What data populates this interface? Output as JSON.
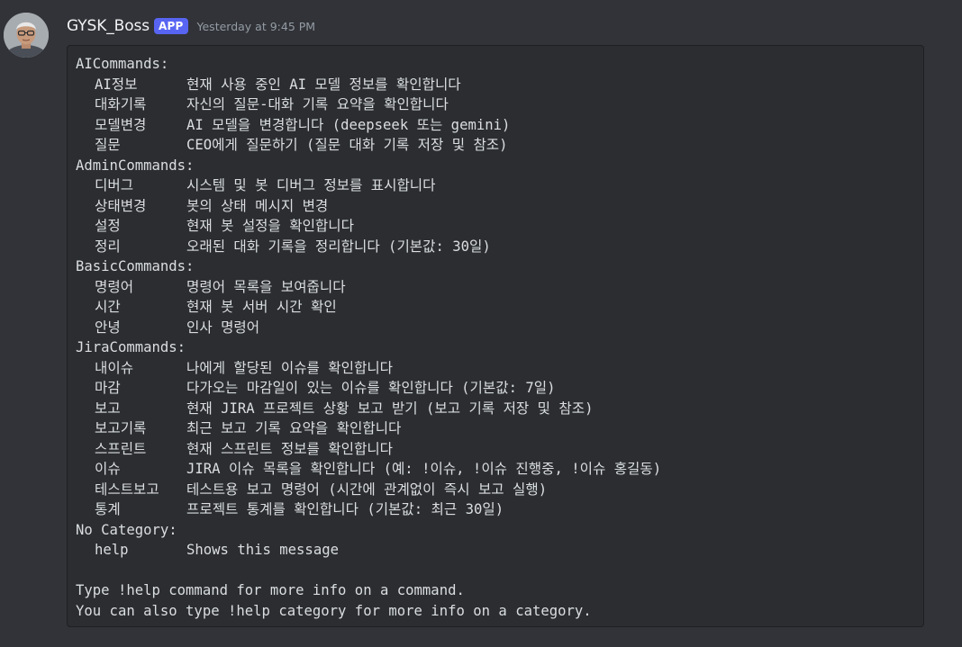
{
  "message": {
    "username": "GYSK_Boss",
    "badge": "APP",
    "timestamp": "Yesterday at 9:45 PM",
    "avatar_icon": "avatar-person-glasses"
  },
  "help": {
    "ai": {
      "title": "AICommands:",
      "items": [
        {
          "cmd": "AI정보",
          "desc": "현재 사용 중인 AI 모델 정보를 확인합니다"
        },
        {
          "cmd": "대화기록",
          "desc": "자신의 질문-대화 기록 요약을 확인합니다"
        },
        {
          "cmd": "모델변경",
          "desc": "AI 모델을 변경합니다 (deepseek 또는 gemini)"
        },
        {
          "cmd": "질문",
          "desc": "CEO에게 질문하기 (질문 대화 기록 저장 및 참조)"
        }
      ]
    },
    "admin": {
      "title": "AdminCommands:",
      "items": [
        {
          "cmd": "디버그",
          "desc": "시스템 및 봇 디버그 정보를 표시합니다"
        },
        {
          "cmd": "상태변경",
          "desc": "봇의 상태 메시지 변경"
        },
        {
          "cmd": "설정",
          "desc": "현재 봇 설정을 확인합니다"
        },
        {
          "cmd": "정리",
          "desc": "오래된 대화 기록을 정리합니다 (기본값: 30일)"
        }
      ]
    },
    "basic": {
      "title": "BasicCommands:",
      "items": [
        {
          "cmd": "명령어",
          "desc": "명령어 목록을 보여줍니다"
        },
        {
          "cmd": "시간",
          "desc": "현재 봇 서버 시간 확인"
        },
        {
          "cmd": "안녕",
          "desc": "인사 명령어"
        }
      ]
    },
    "jira": {
      "title": "JiraCommands:",
      "items": [
        {
          "cmd": "내이슈",
          "desc": "나에게 할당된 이슈를 확인합니다"
        },
        {
          "cmd": "마감",
          "desc": "다가오는 마감일이 있는 이슈를 확인합니다 (기본값: 7일)"
        },
        {
          "cmd": "보고",
          "desc": "현재 JIRA 프로젝트 상황 보고 받기 (보고 기록 저장 및 참조)"
        },
        {
          "cmd": "보고기록",
          "desc": "최근 보고 기록 요약을 확인합니다"
        },
        {
          "cmd": "스프린트",
          "desc": "현재 스프린트 정보를 확인합니다"
        },
        {
          "cmd": "이슈",
          "desc": "JIRA 이슈 목록을 확인합니다 (예: !이슈, !이슈 진행중, !이슈 홍길동)"
        },
        {
          "cmd": "테스트보고",
          "desc": "테스트용 보고 명령어 (시간에 관계없이 즉시 보고 실행)"
        },
        {
          "cmd": "통계",
          "desc": "프로젝트 통계를 확인합니다 (기본값: 최근 30일)"
        }
      ]
    },
    "none": {
      "title": "No Category:",
      "items": [
        {
          "cmd": "help",
          "desc": "Shows this message"
        }
      ]
    },
    "footer": [
      "Type !help command for more info on a command.",
      "You can also type !help category for more info on a category."
    ]
  }
}
